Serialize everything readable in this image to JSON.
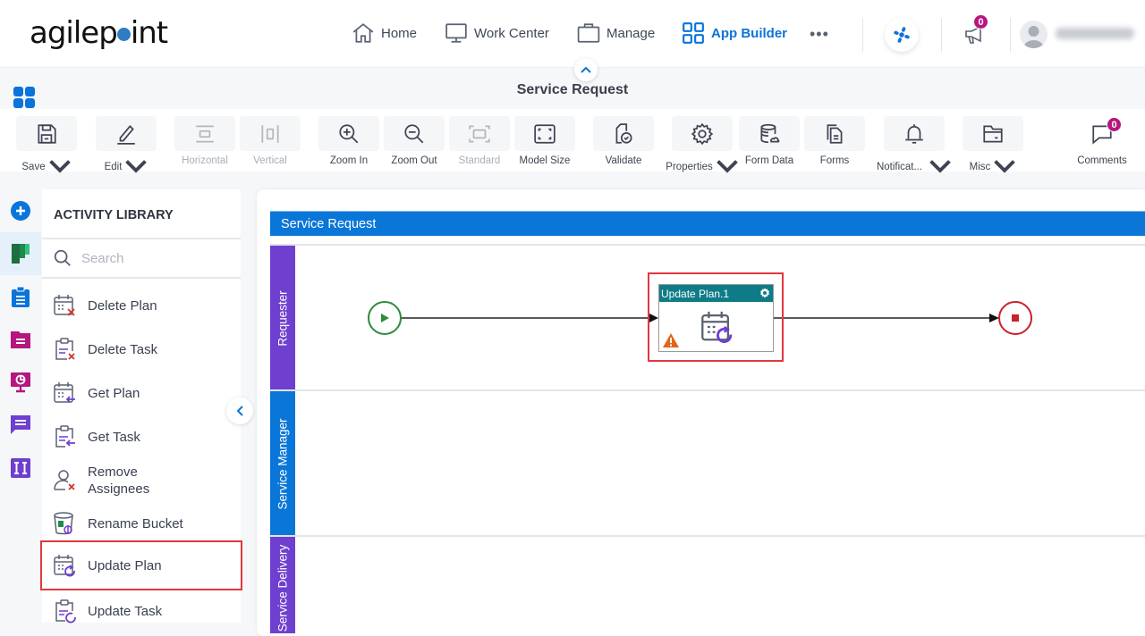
{
  "brand": {
    "logo_text_before": "agilep",
    "logo_text_after": "int",
    "logo_dot_color": "#2f7bc4"
  },
  "nav": {
    "items": [
      {
        "label": "Home",
        "icon": "home-icon"
      },
      {
        "label": "Work Center",
        "icon": "monitor-icon"
      },
      {
        "label": "Manage",
        "icon": "briefcase-icon"
      },
      {
        "label": "App Builder",
        "icon": "grid-icon",
        "active": true
      }
    ],
    "more": "•••",
    "notifications_count": "0",
    "accent_color": "#0a74da"
  },
  "page": {
    "title": "Service Request"
  },
  "toolbar": {
    "save": "Save",
    "edit": "Edit",
    "horizontal": "Horizontal",
    "vertical": "Vertical",
    "zoom_in": "Zoom In",
    "zoom_out": "Zoom Out",
    "standard": "Standard",
    "model_size": "Model Size",
    "validate": "Validate",
    "properties": "Properties",
    "form_data": "Form Data",
    "forms": "Forms",
    "notifications": "Notificat...",
    "misc": "Misc",
    "comments": "Comments",
    "comments_count": "0"
  },
  "library": {
    "title": "ACTIVITY LIBRARY",
    "search_placeholder": "Search",
    "items": [
      {
        "label": "Delete Plan",
        "icon": "calendar-delete-icon"
      },
      {
        "label": "Delete Task",
        "icon": "clipboard-delete-icon"
      },
      {
        "label": "Get Plan",
        "icon": "calendar-get-icon"
      },
      {
        "label": "Get Task",
        "icon": "clipboard-get-icon"
      },
      {
        "label": "Remove Assignees",
        "icon": "user-remove-icon"
      },
      {
        "label": "Rename Bucket",
        "icon": "bucket-rename-icon"
      },
      {
        "label": "Update Plan",
        "icon": "calendar-update-icon",
        "highlighted": true
      },
      {
        "label": "Update Task",
        "icon": "clipboard-update-icon"
      }
    ]
  },
  "canvas": {
    "pool_title": "Service Request",
    "lanes": [
      {
        "label": "Requester",
        "color": "#6f3fcf"
      },
      {
        "label": "Service Manager",
        "color": "#0a76d8"
      },
      {
        "label": "Service Delivery",
        "color": "#6f3fcf"
      }
    ],
    "activity": {
      "title": "Update Plan.1",
      "status": "warning"
    }
  }
}
